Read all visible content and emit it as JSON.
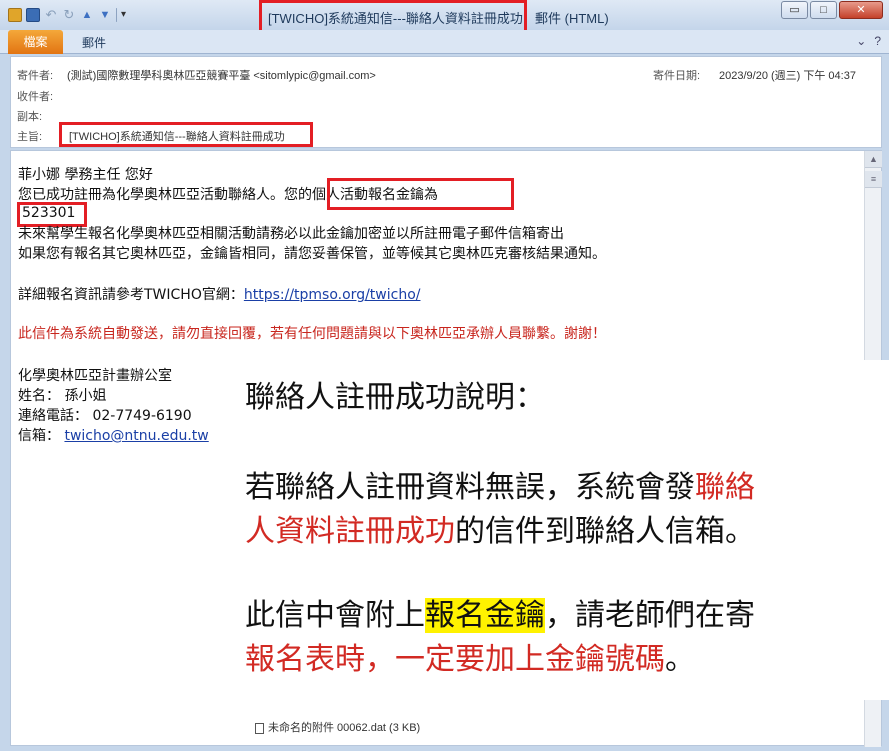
{
  "window": {
    "title": "[TWICHO]系統通知信---聯絡人資料註冊成功",
    "title_suffix": "郵件 (HTML)",
    "buttons": {
      "minimize": "▭",
      "maximize": "□",
      "close": "✕"
    }
  },
  "ribbon": {
    "file_tab": "檔案",
    "message_tab": "郵件",
    "help_icon": "?"
  },
  "header": {
    "from_label": "寄件者:",
    "from_value": "(測試)國際數理學科奧林匹亞競賽平臺 <sitomlypic@gmail.com>",
    "date_label": "寄件日期:",
    "date_value": "2023/9/20 (週三) 下午 04:37",
    "to_label": "收件者:",
    "cc_label": "副本:",
    "subject_label": "主旨:",
    "subject_value": "[TWICHO]系統通知信---聯絡人資料註冊成功"
  },
  "body": {
    "greeting": "菲小娜 學務主任 您好",
    "line1a": "您已成功註冊為化學奧林匹亞活動聯絡人。",
    "line1b": "您的個人活動報名金鑰為",
    "key": "523301",
    "line3": "未來幫學生報名化學奧林匹亞相關活動請務必以此金鑰加密並以所註冊電子郵件信箱寄出",
    "line4": "如果您有報名其它奧林匹亞，金鑰皆相同，請您妥善保管，並等候其它奧林匹克審核結果通知。",
    "line5_text": "詳細報名資訊請參考TWICHO官網：",
    "line5_link": "https://tpmso.org/twicho/",
    "warning": "此信件為系統自動發送，請勿直接回覆，若有任何問題請與以下奧林匹亞承辦人員聯繫。謝謝！",
    "office": "化學奧林匹亞計畫辦公室",
    "name": "姓名： 孫小姐",
    "phone": "連絡電話： 02-7749-6190",
    "mail_label": "信箱：",
    "mail_link": "twicho@ntnu.edu.tw"
  },
  "attachment": "未命名的附件 00062.dat (3 KB)",
  "overlay": {
    "heading": "聯絡人註冊成功說明：",
    "p1_a": "若聯絡人註冊資料無誤，系統會發",
    "p1_b": "聯絡",
    "p1_c": "人資料註冊成功",
    "p1_d": "的信件到聯絡人信箱。",
    "p2_a": "此信中會附上",
    "p2_b": "報名金鑰",
    "p2_c": "，請老師們在寄",
    "p2_d": "報名表時，一定要加上金鑰號碼",
    "p2_e": "。"
  }
}
